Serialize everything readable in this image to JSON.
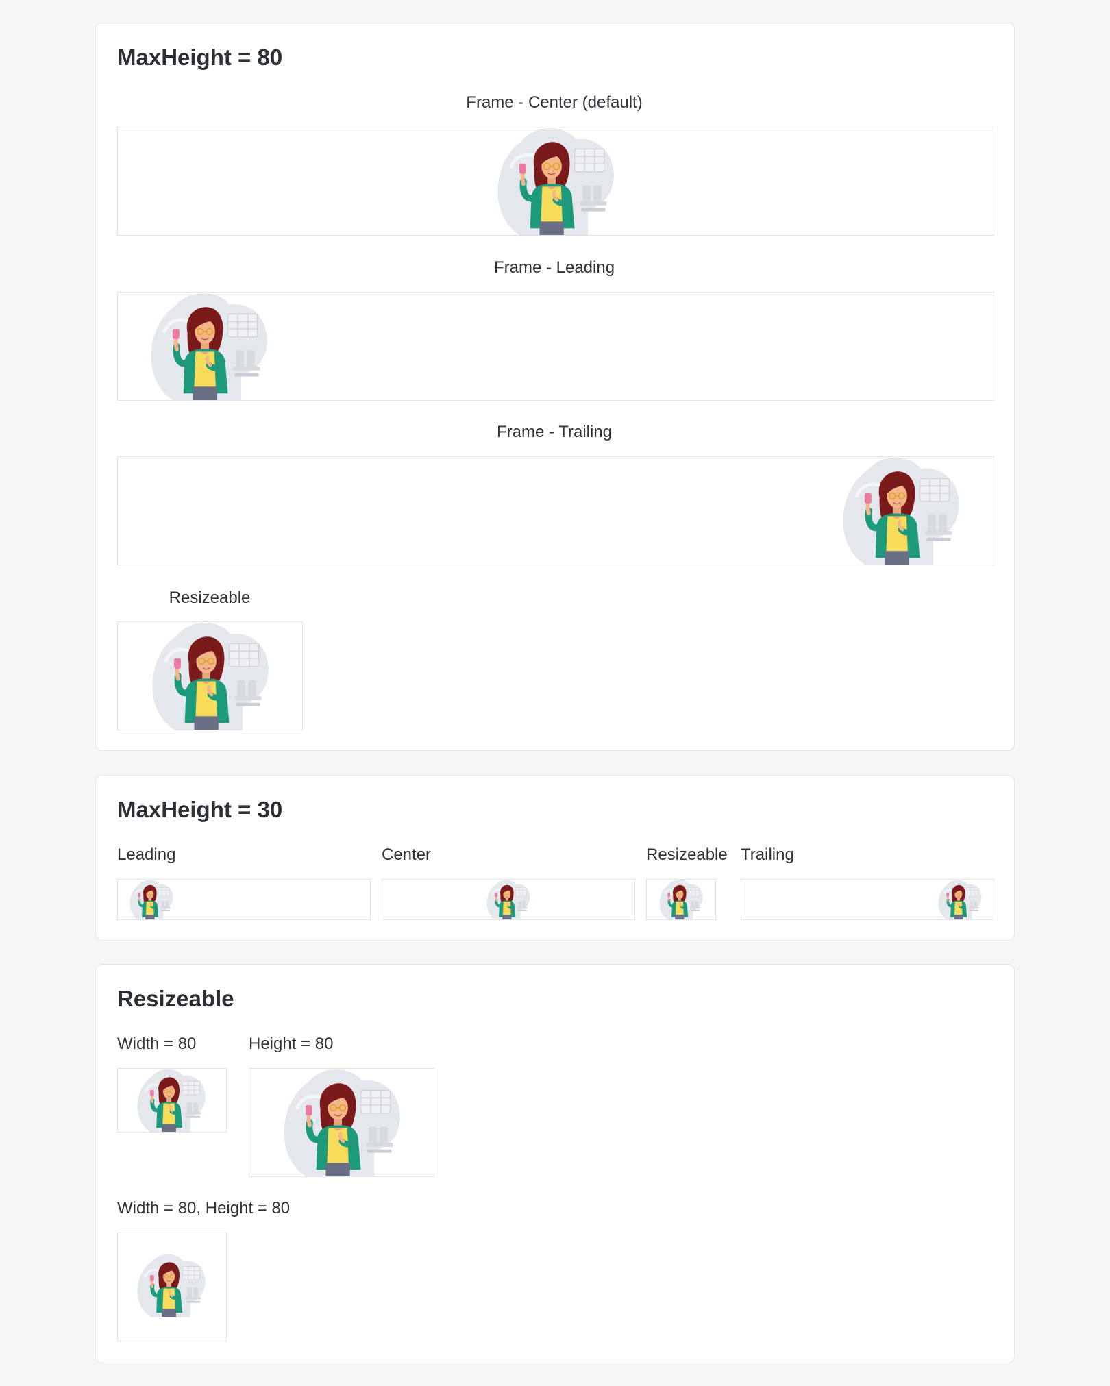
{
  "section1": {
    "title": "MaxHeight = 80",
    "center_label": "Frame - Center (default)",
    "leading_label": "Frame - Leading",
    "trailing_label": "Frame - Trailing",
    "resizeable_label": "Resizeable"
  },
  "section2": {
    "title": "MaxHeight = 30",
    "leading_label": "Leading",
    "center_label": "Center",
    "resizeable_label": "Resizeable",
    "trailing_label": "Trailing"
  },
  "section3": {
    "title": "Resizeable",
    "width_label": "Width = 80",
    "height_label": "Height = 80",
    "both_label": "Width = 80, Height = 80"
  },
  "illustration": {
    "icon": "woman-with-phone-illustration",
    "colors": {
      "blob": "#dfe3e8",
      "hair": "#7a1a1a",
      "skin": "#f3b58a",
      "shirt": "#f6dc5a",
      "jacket": "#1d9a7c",
      "pants": "#6b6f86",
      "phone": "#e97aa0"
    }
  }
}
